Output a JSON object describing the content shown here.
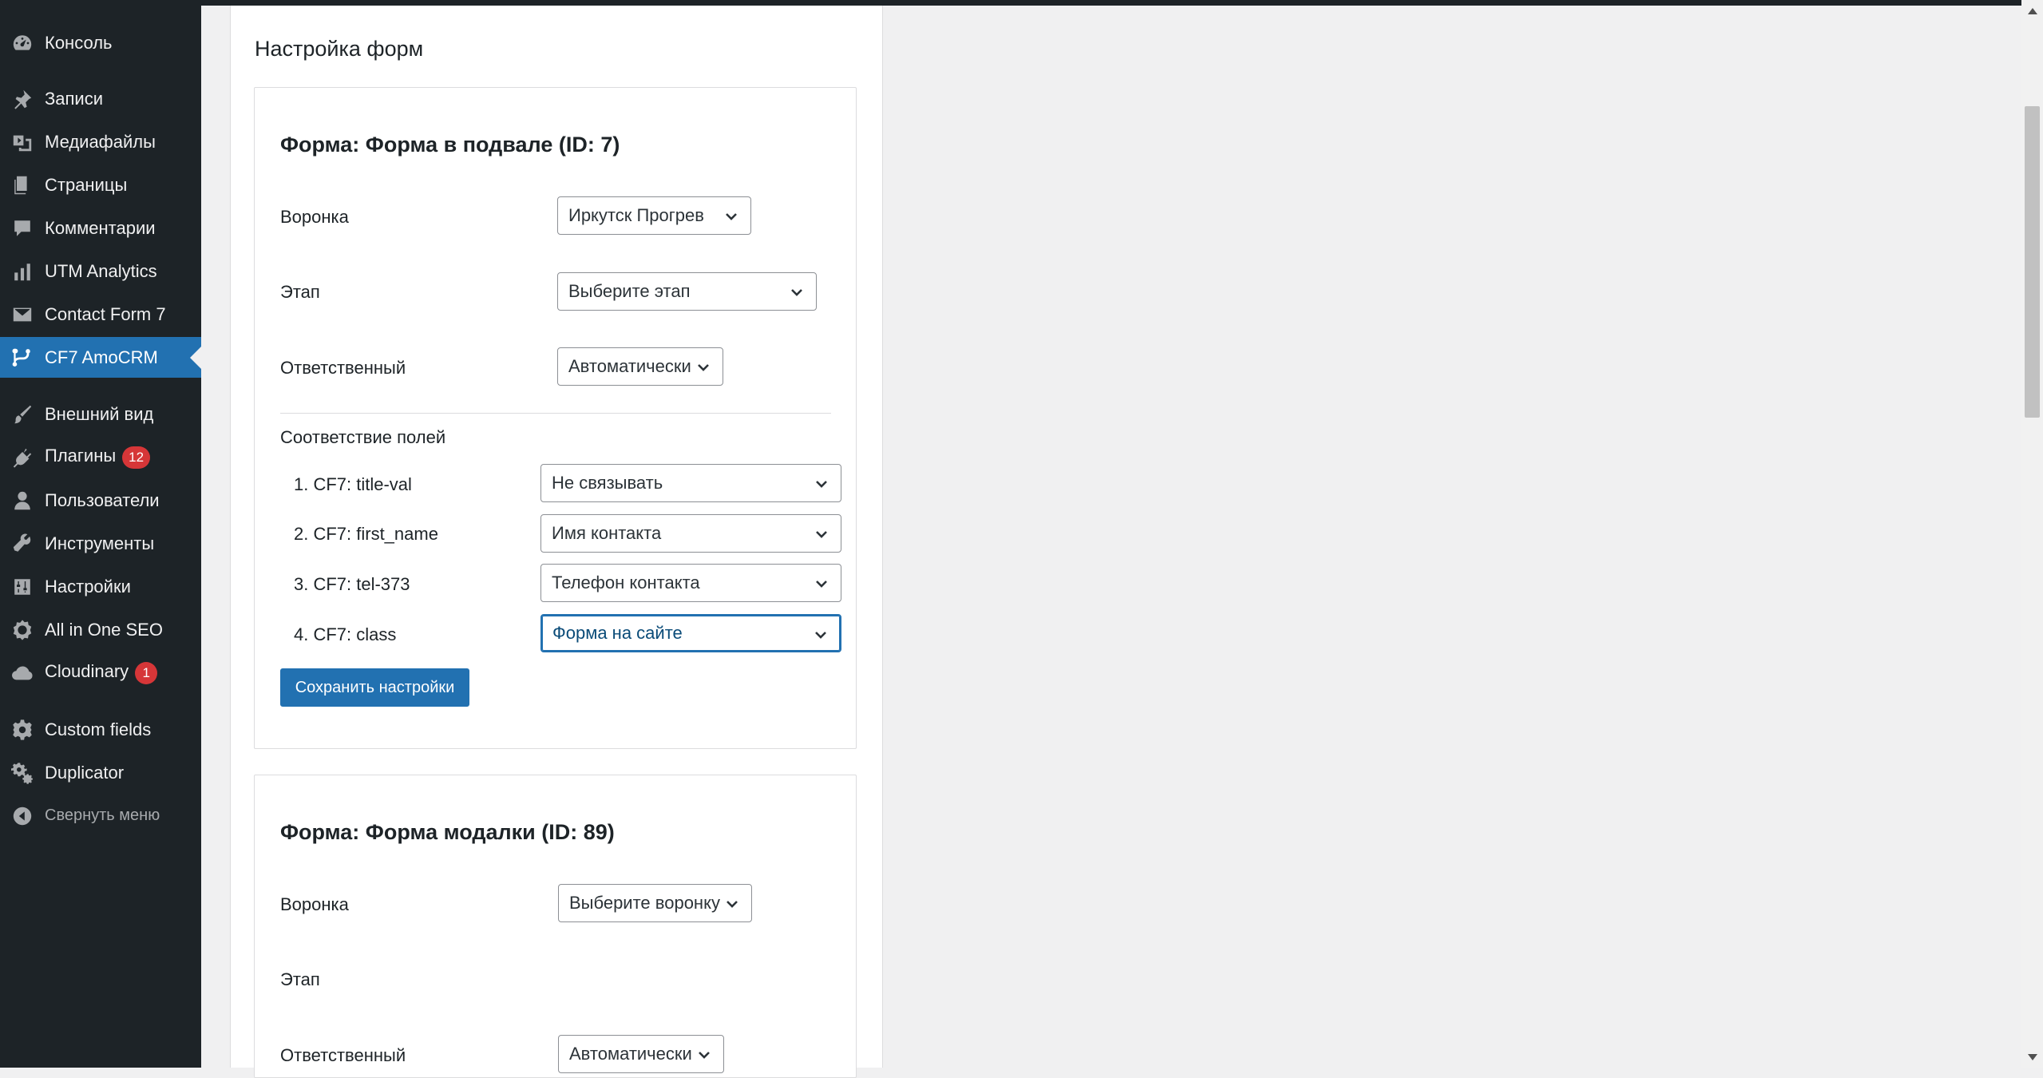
{
  "sidebar": {
    "items": [
      {
        "label": "Консоль",
        "icon": "dashboard-icon"
      },
      {
        "label": "Записи",
        "icon": "pin-icon"
      },
      {
        "label": "Медиафайлы",
        "icon": "media-icon"
      },
      {
        "label": "Страницы",
        "icon": "pages-icon"
      },
      {
        "label": "Комментарии",
        "icon": "comment-icon"
      },
      {
        "label": "UTM Analytics",
        "icon": "chart-bars-icon"
      },
      {
        "label": "Contact Form 7",
        "icon": "envelope-icon"
      },
      {
        "label": "CF7 AmoCRM",
        "icon": "network-icon"
      },
      {
        "label": "Внешний вид",
        "icon": "brush-icon"
      },
      {
        "label": "Плагины",
        "icon": "plugin-icon",
        "badge": "12"
      },
      {
        "label": "Пользователи",
        "icon": "user-icon"
      },
      {
        "label": "Инструменты",
        "icon": "wrench-icon"
      },
      {
        "label": "Настройки",
        "icon": "settings-sliders-icon"
      },
      {
        "label": "All in One SEO",
        "icon": "seo-icon"
      },
      {
        "label": "Cloudinary",
        "icon": "cloud-icon",
        "badge": "1"
      },
      {
        "label": "Custom fields",
        "icon": "gear-icon"
      },
      {
        "label": "Duplicator",
        "icon": "gears-icon"
      },
      {
        "label": "Свернуть меню",
        "icon": "collapse-arrow-icon"
      }
    ],
    "active_label": "CF7 AmoCRM"
  },
  "main": {
    "section_title": "Настройка форм",
    "forms": [
      {
        "title": "Форма: Форма в подвале (ID: 7)",
        "funnel_label": "Воронка",
        "funnel_value": "Иркутск Прогрев",
        "stage_label": "Этап",
        "stage_value": "Выберите этап",
        "responsible_label": "Ответственный",
        "responsible_value": "Автоматически",
        "mapping_title": "Соответствие полей",
        "mappings": [
          {
            "field": "1. CF7: title-val",
            "value": "Не связывать"
          },
          {
            "field": "2. CF7: first_name",
            "value": "Имя контакта"
          },
          {
            "field": "3. CF7: tel-373",
            "value": "Телефон контакта"
          },
          {
            "field": "4. CF7: class",
            "value": "Форма на сайте"
          }
        ],
        "save_label": "Сохранить настройки"
      },
      {
        "title": "Форма: Форма модалки (ID: 89)",
        "funnel_label": "Воронка",
        "funnel_value": "Выберите воронку",
        "stage_label": "Этап",
        "responsible_label": "Ответственный",
        "responsible_value": "Автоматически"
      }
    ]
  },
  "colors": {
    "sidebar_bg": "#1d2327",
    "accent": "#2271b1",
    "badge": "#d63638",
    "page_bg": "#f0f0f1"
  }
}
